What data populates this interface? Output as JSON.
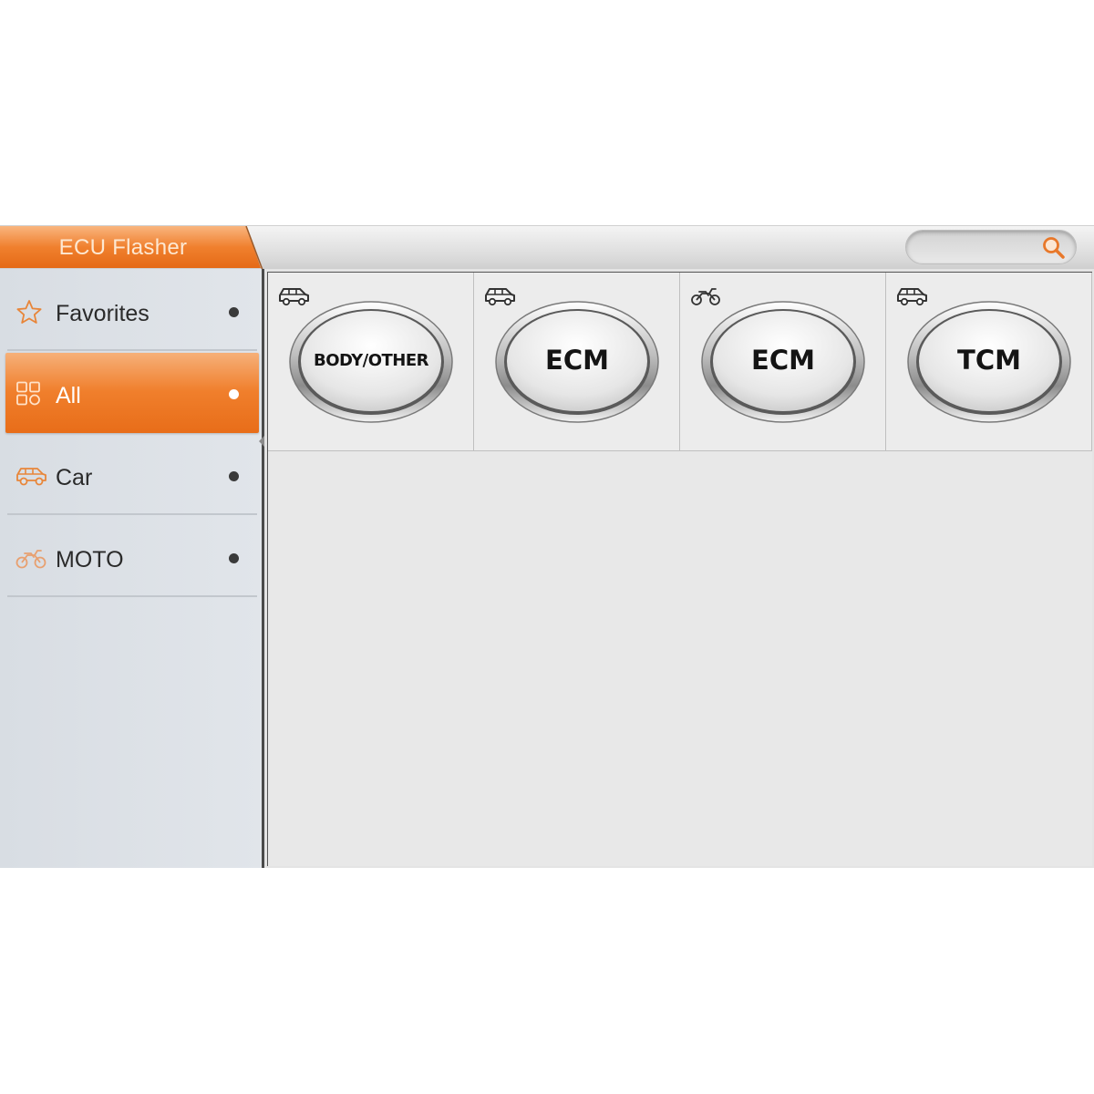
{
  "app": {
    "title": "ECU Flasher"
  },
  "search": {
    "icon": "search-icon",
    "placeholder": ""
  },
  "sidebar": {
    "items": [
      {
        "label": "Favorites",
        "icon": "star-icon",
        "active": false
      },
      {
        "label": "All",
        "icon": "grid-icon",
        "active": true
      },
      {
        "label": "Car",
        "icon": "car-icon",
        "active": false
      },
      {
        "label": "MOTO",
        "icon": "motorcycle-icon",
        "active": false
      }
    ]
  },
  "modules": [
    {
      "label": "BODY/OTHER",
      "icon": "car-icon"
    },
    {
      "label": "ECM",
      "icon": "car-icon"
    },
    {
      "label": "ECM",
      "icon": "motorcycle-icon"
    },
    {
      "label": "TCM",
      "icon": "car-icon"
    }
  ],
  "colors": {
    "accent": "#f07f2c",
    "accent_light": "#f6b079",
    "sidebar_bg": "#dde1e6",
    "main_bg": "#e8e8e8"
  }
}
